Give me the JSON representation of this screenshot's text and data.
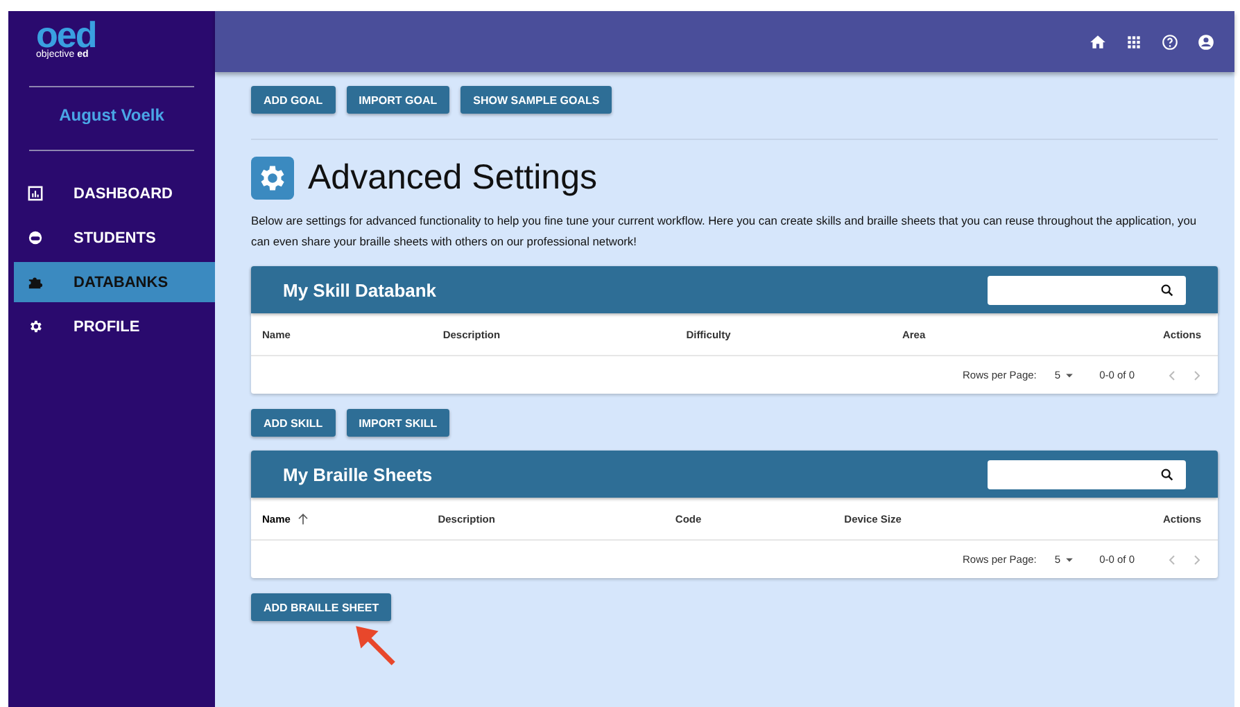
{
  "sidebar": {
    "logo": "oed",
    "logo_caption_light": "objective",
    "logo_caption_bold": "ed",
    "user": "August Voelk",
    "items": [
      {
        "label": "DASHBOARD",
        "selected": false
      },
      {
        "label": "STUDENTS",
        "selected": false
      },
      {
        "label": "DATABANKS",
        "selected": true
      },
      {
        "label": "PROFILE",
        "selected": false
      }
    ]
  },
  "goal_buttons": [
    "ADD GOAL",
    "IMPORT GOAL",
    "SHOW SAMPLE GOALS"
  ],
  "title": "Advanced Settings",
  "description": "Below are settings for advanced functionality to help you fine tune your current workflow. Here you can create skills and braille sheets that you can reuse throughout the application, you can even share your braille sheets with others on our professional network!",
  "tables": [
    {
      "title": "My Skill Databank",
      "columns": [
        {
          "label": "Name",
          "sorted": false
        },
        {
          "label": "Description",
          "sorted": false
        },
        {
          "label": "Difficulty",
          "sorted": false
        },
        {
          "label": "Area",
          "sorted": false
        },
        {
          "label": "Actions",
          "sorted": false
        }
      ],
      "rows_per_page_label": "Rows per Page:",
      "rows_per_page": "5",
      "range": "0-0 of 0",
      "buttons": [
        "ADD SKILL",
        "IMPORT SKILL"
      ]
    },
    {
      "title": "My Braille Sheets",
      "columns": [
        {
          "label": "Name",
          "sorted": true
        },
        {
          "label": "Description",
          "sorted": false
        },
        {
          "label": "Code",
          "sorted": false
        },
        {
          "label": "Device Size",
          "sorted": false
        },
        {
          "label": "Actions",
          "sorted": false
        }
      ],
      "rows_per_page_label": "Rows per Page:",
      "rows_per_page": "5",
      "range": "0-0 of 0",
      "buttons": [
        "ADD BRAILLE SHEET"
      ]
    }
  ]
}
